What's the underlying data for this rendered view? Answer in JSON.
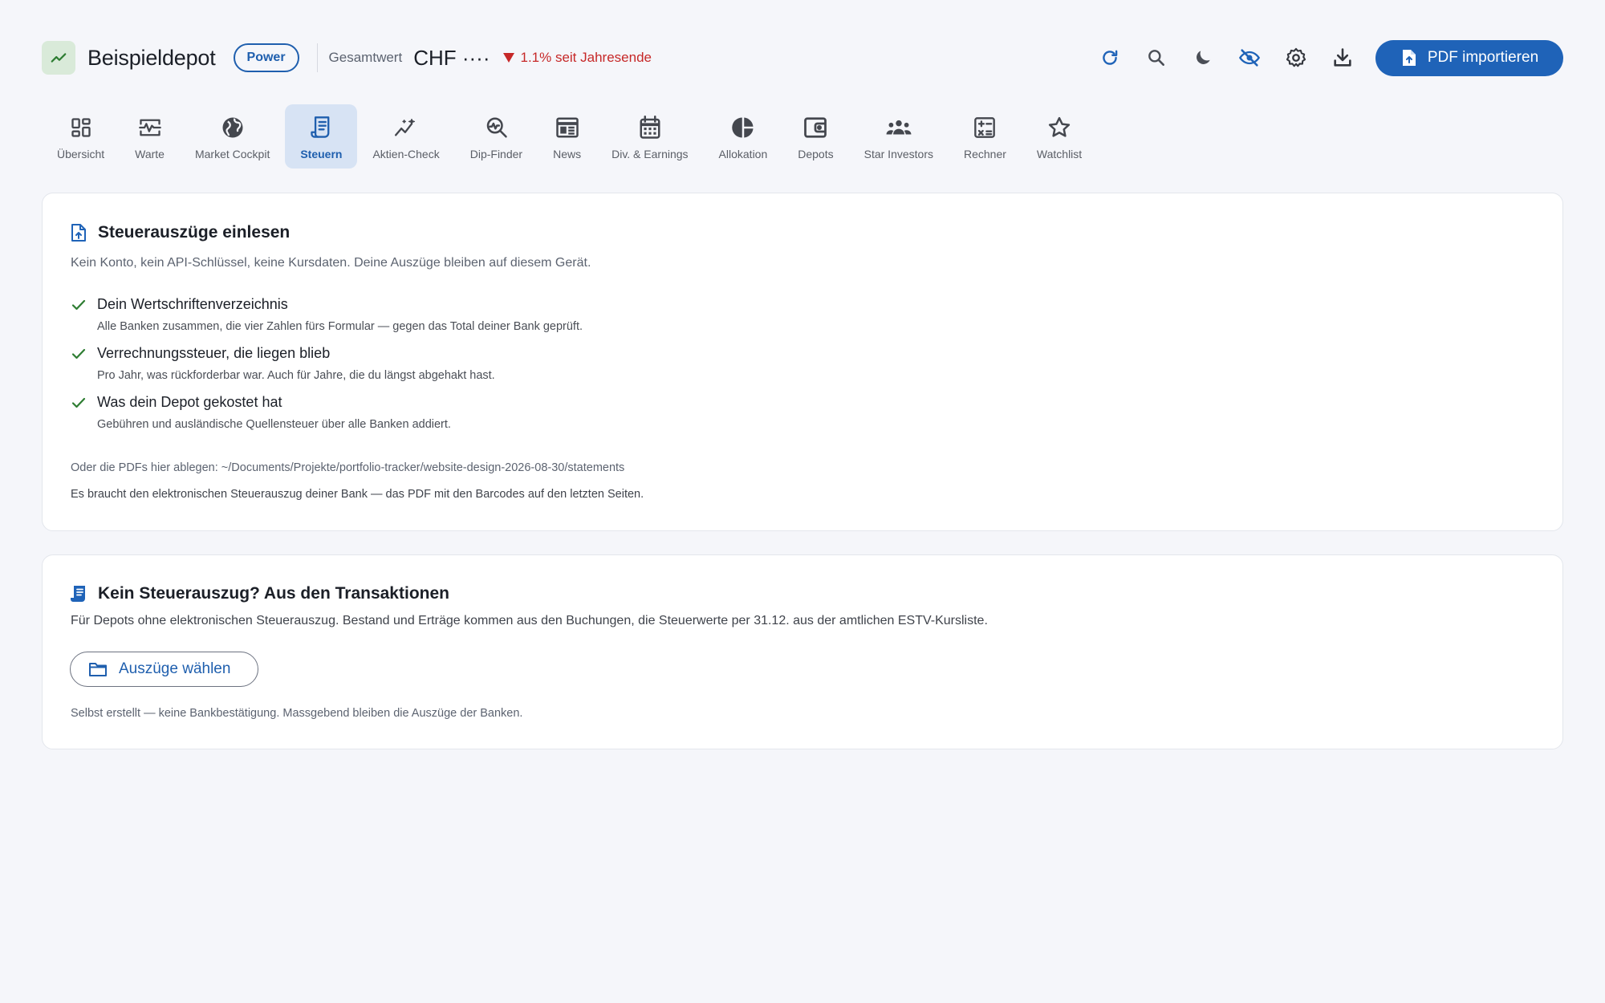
{
  "header": {
    "title": "Beispieldepot",
    "tier": "Power",
    "total_label": "Gesamtwert",
    "total_value": "CHF ····",
    "change_text": "1.1% seit Jahresende",
    "import_label": "PDF importieren",
    "icons": [
      "refresh-icon",
      "search-icon",
      "dark-mode-icon",
      "hide-values-icon",
      "settings-icon",
      "download-icon"
    ]
  },
  "tabs": [
    {
      "label": "Übersicht",
      "icon": "dashboard-icon"
    },
    {
      "label": "Warte",
      "icon": "monitor-icon"
    },
    {
      "label": "Market Cockpit",
      "icon": "globe-icon"
    },
    {
      "label": "Steuern",
      "icon": "receipt-icon",
      "active": true
    },
    {
      "label": "Aktien-Check",
      "icon": "sparkline-icon"
    },
    {
      "label": "Dip-Finder",
      "icon": "search-chart-icon"
    },
    {
      "label": "News",
      "icon": "newspaper-icon"
    },
    {
      "label": "Div. & Earnings",
      "icon": "calendar-icon"
    },
    {
      "label": "Allokation",
      "icon": "pie-chart-icon"
    },
    {
      "label": "Depots",
      "icon": "wallet-icon"
    },
    {
      "label": "Star Investors",
      "icon": "people-icon"
    },
    {
      "label": "Rechner",
      "icon": "calculator-icon"
    },
    {
      "label": "Watchlist",
      "icon": "star-icon"
    }
  ],
  "import_card": {
    "title": "Steuerauszüge einlesen",
    "subtitle": "Kein Konto, kein API-Schlüssel, keine Kursdaten. Deine Auszüge bleiben auf diesem Gerät.",
    "features": [
      {
        "title": "Dein Wertschriftenverzeichnis",
        "desc": "Alle Banken zusammen, die vier Zahlen fürs Formular — gegen das Total deiner Bank geprüft."
      },
      {
        "title": "Verrechnungssteuer, die liegen blieb",
        "desc": "Pro Jahr, was rückforderbar war. Auch für Jahre, die du längst abgehakt hast."
      },
      {
        "title": "Was dein Depot gekostet hat",
        "desc": "Gebühren und ausländische Quellensteuer über alle Banken addiert."
      }
    ],
    "folder_note": "Oder die PDFs hier ablegen: ~/Documents/Projekte/portfolio-tracker/website-design-2026-08-30/statements",
    "requirement_note": "Es braucht den elektronischen Steuerauszug deiner Bank — das PDF mit den Barcodes auf den letzten Seiten."
  },
  "transactions_card": {
    "title": "Kein Steuerauszug? Aus den Transaktionen",
    "subtitle": "Für Depots ohne elektronischen Steuerauszug. Bestand und Erträge kommen aus den Buchungen, die Steuerwerte per 31.12. aus der amtlichen ESTV-Kursliste.",
    "button_label": "Auszüge wählen",
    "disclaimer": "Selbst erstellt — keine Bankbestätigung. Massgebend bleiben die Auszüge der Banken."
  },
  "colors": {
    "accent": "#1f63b8",
    "negative": "#c62828",
    "success": "#2e7d32",
    "active_tab_bg": "#d7e3f4"
  }
}
